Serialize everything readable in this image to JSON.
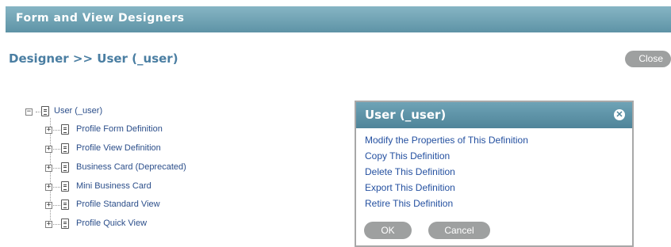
{
  "header": {
    "title": "Form and View Designers"
  },
  "breadcrumb": "Designer >> User (_user)",
  "close_label": "Close",
  "tree": {
    "root": {
      "expander": "−",
      "label": "User (_user)"
    },
    "children": [
      {
        "expander": "+",
        "label": "Profile Form Definition"
      },
      {
        "expander": "+",
        "label": "Profile View Definition"
      },
      {
        "expander": "+",
        "label": "Business Card (Deprecated)"
      },
      {
        "expander": "+",
        "label": "Mini Business Card"
      },
      {
        "expander": "+",
        "label": "Profile Standard View"
      },
      {
        "expander": "+",
        "label": "Profile Quick View"
      }
    ]
  },
  "dialog": {
    "title": "User (_user)",
    "close_glyph": "✕",
    "actions": [
      "Modify the Properties of This Definition",
      "Copy This Definition",
      "Delete This Definition",
      "Export This Definition",
      "Retire This Definition"
    ],
    "ok_label": "OK",
    "cancel_label": "Cancel"
  },
  "colors": {
    "header_bg": "#6fa2b5",
    "link": "#2450a0",
    "breadcrumb": "#4a7ea2",
    "pill": "#9ea0a0"
  }
}
